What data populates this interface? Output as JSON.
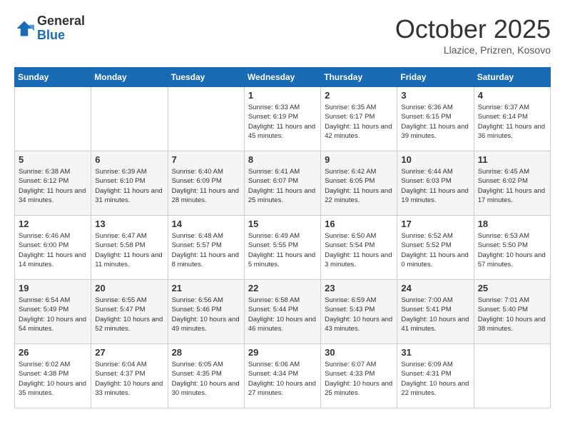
{
  "header": {
    "logo_general": "General",
    "logo_blue": "Blue",
    "month": "October 2025",
    "location": "Llazice, Prizren, Kosovo"
  },
  "days_of_week": [
    "Sunday",
    "Monday",
    "Tuesday",
    "Wednesday",
    "Thursday",
    "Friday",
    "Saturday"
  ],
  "weeks": [
    [
      {
        "day": "",
        "content": ""
      },
      {
        "day": "",
        "content": ""
      },
      {
        "day": "",
        "content": ""
      },
      {
        "day": "1",
        "content": "Sunrise: 6:33 AM\nSunset: 6:19 PM\nDaylight: 11 hours\nand 45 minutes."
      },
      {
        "day": "2",
        "content": "Sunrise: 6:35 AM\nSunset: 6:17 PM\nDaylight: 11 hours\nand 42 minutes."
      },
      {
        "day": "3",
        "content": "Sunrise: 6:36 AM\nSunset: 6:15 PM\nDaylight: 11 hours\nand 39 minutes."
      },
      {
        "day": "4",
        "content": "Sunrise: 6:37 AM\nSunset: 6:14 PM\nDaylight: 11 hours\nand 36 minutes."
      }
    ],
    [
      {
        "day": "5",
        "content": "Sunrise: 6:38 AM\nSunset: 6:12 PM\nDaylight: 11 hours\nand 34 minutes."
      },
      {
        "day": "6",
        "content": "Sunrise: 6:39 AM\nSunset: 6:10 PM\nDaylight: 11 hours\nand 31 minutes."
      },
      {
        "day": "7",
        "content": "Sunrise: 6:40 AM\nSunset: 6:09 PM\nDaylight: 11 hours\nand 28 minutes."
      },
      {
        "day": "8",
        "content": "Sunrise: 6:41 AM\nSunset: 6:07 PM\nDaylight: 11 hours\nand 25 minutes."
      },
      {
        "day": "9",
        "content": "Sunrise: 6:42 AM\nSunset: 6:05 PM\nDaylight: 11 hours\nand 22 minutes."
      },
      {
        "day": "10",
        "content": "Sunrise: 6:44 AM\nSunset: 6:03 PM\nDaylight: 11 hours\nand 19 minutes."
      },
      {
        "day": "11",
        "content": "Sunrise: 6:45 AM\nSunset: 6:02 PM\nDaylight: 11 hours\nand 17 minutes."
      }
    ],
    [
      {
        "day": "12",
        "content": "Sunrise: 6:46 AM\nSunset: 6:00 PM\nDaylight: 11 hours\nand 14 minutes."
      },
      {
        "day": "13",
        "content": "Sunrise: 6:47 AM\nSunset: 5:58 PM\nDaylight: 11 hours\nand 11 minutes."
      },
      {
        "day": "14",
        "content": "Sunrise: 6:48 AM\nSunset: 5:57 PM\nDaylight: 11 hours\nand 8 minutes."
      },
      {
        "day": "15",
        "content": "Sunrise: 6:49 AM\nSunset: 5:55 PM\nDaylight: 11 hours\nand 5 minutes."
      },
      {
        "day": "16",
        "content": "Sunrise: 6:50 AM\nSunset: 5:54 PM\nDaylight: 11 hours\nand 3 minutes."
      },
      {
        "day": "17",
        "content": "Sunrise: 6:52 AM\nSunset: 5:52 PM\nDaylight: 11 hours\nand 0 minutes."
      },
      {
        "day": "18",
        "content": "Sunrise: 6:53 AM\nSunset: 5:50 PM\nDaylight: 10 hours\nand 57 minutes."
      }
    ],
    [
      {
        "day": "19",
        "content": "Sunrise: 6:54 AM\nSunset: 5:49 PM\nDaylight: 10 hours\nand 54 minutes."
      },
      {
        "day": "20",
        "content": "Sunrise: 6:55 AM\nSunset: 5:47 PM\nDaylight: 10 hours\nand 52 minutes."
      },
      {
        "day": "21",
        "content": "Sunrise: 6:56 AM\nSunset: 5:46 PM\nDaylight: 10 hours\nand 49 minutes."
      },
      {
        "day": "22",
        "content": "Sunrise: 6:58 AM\nSunset: 5:44 PM\nDaylight: 10 hours\nand 46 minutes."
      },
      {
        "day": "23",
        "content": "Sunrise: 6:59 AM\nSunset: 5:43 PM\nDaylight: 10 hours\nand 43 minutes."
      },
      {
        "day": "24",
        "content": "Sunrise: 7:00 AM\nSunset: 5:41 PM\nDaylight: 10 hours\nand 41 minutes."
      },
      {
        "day": "25",
        "content": "Sunrise: 7:01 AM\nSunset: 5:40 PM\nDaylight: 10 hours\nand 38 minutes."
      }
    ],
    [
      {
        "day": "26",
        "content": "Sunrise: 6:02 AM\nSunset: 4:38 PM\nDaylight: 10 hours\nand 35 minutes."
      },
      {
        "day": "27",
        "content": "Sunrise: 6:04 AM\nSunset: 4:37 PM\nDaylight: 10 hours\nand 33 minutes."
      },
      {
        "day": "28",
        "content": "Sunrise: 6:05 AM\nSunset: 4:35 PM\nDaylight: 10 hours\nand 30 minutes."
      },
      {
        "day": "29",
        "content": "Sunrise: 6:06 AM\nSunset: 4:34 PM\nDaylight: 10 hours\nand 27 minutes."
      },
      {
        "day": "30",
        "content": "Sunrise: 6:07 AM\nSunset: 4:33 PM\nDaylight: 10 hours\nand 25 minutes."
      },
      {
        "day": "31",
        "content": "Sunrise: 6:09 AM\nSunset: 4:31 PM\nDaylight: 10 hours\nand 22 minutes."
      },
      {
        "day": "",
        "content": ""
      }
    ]
  ]
}
